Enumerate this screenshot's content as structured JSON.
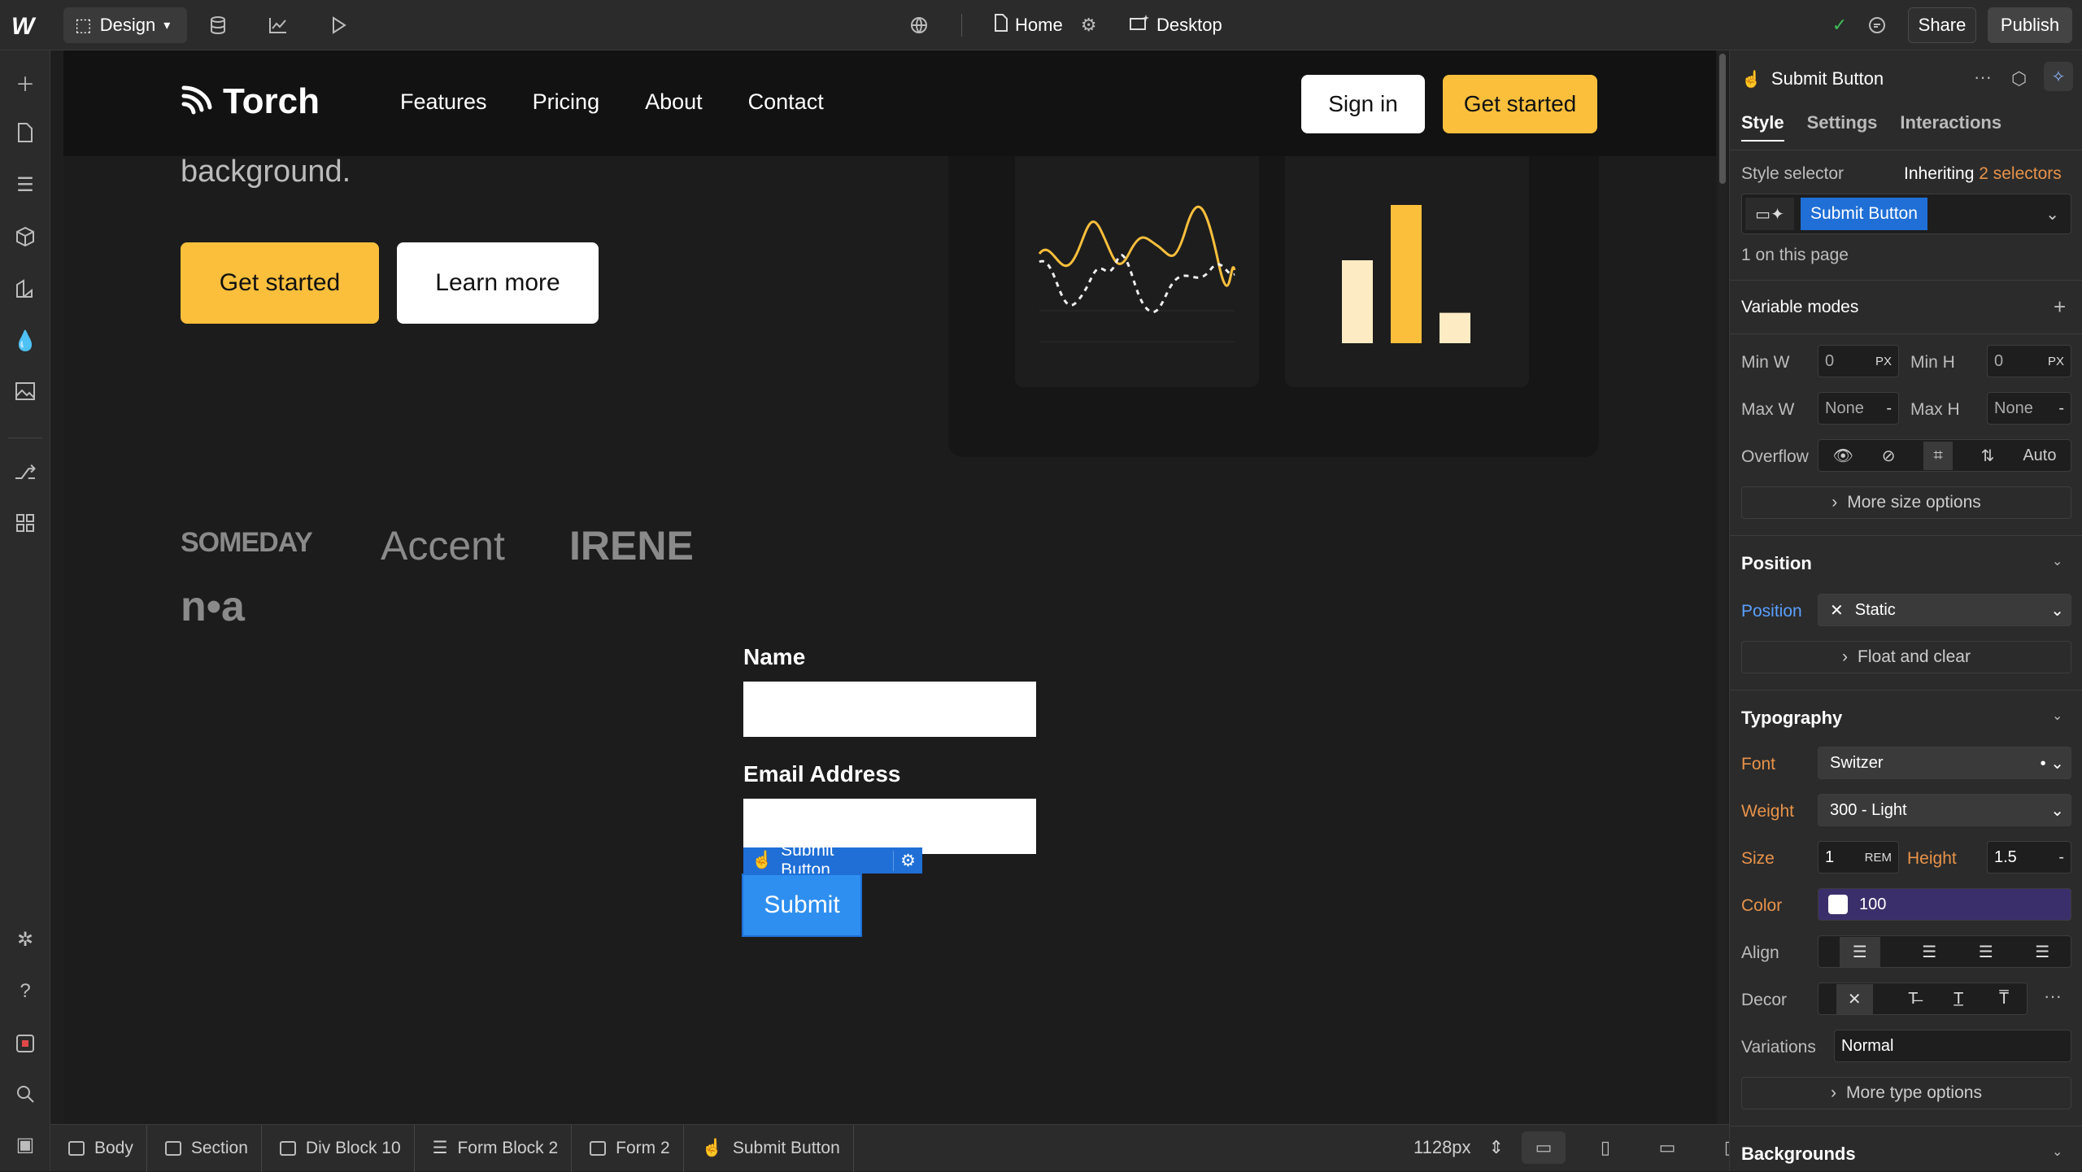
{
  "topbar": {
    "mode_label": "Design",
    "page_name": "Home",
    "device_name": "Desktop",
    "share_label": "Share",
    "publish_label": "Publish"
  },
  "site": {
    "brand": "Torch",
    "nav_links": [
      "Features",
      "Pricing",
      "About",
      "Contact"
    ],
    "signin_label": "Sign in",
    "nav_cta_label": "Get started",
    "hero_text": "background.",
    "hero_cta_primary": "Get started",
    "hero_cta_secondary": "Learn more",
    "logos": [
      "SOMEDAY",
      "Accent",
      "IRENE",
      "n•a"
    ],
    "form": {
      "name_label": "Name",
      "email_label": "Email Address",
      "submit_label": "Submit"
    },
    "bar_heights_fraction": [
      0.6,
      1.0,
      0.22
    ]
  },
  "selection": {
    "tag_label": "Submit Button"
  },
  "breadcrumbs": [
    "Body",
    "Section",
    "Div Block 10",
    "Form Block 2",
    "Form 2",
    "Submit Button"
  ],
  "canvas_width_label": "1128px",
  "panel": {
    "element_name": "Submit Button",
    "tabs": [
      "Style",
      "Settings",
      "Interactions"
    ],
    "style_selector_label": "Style selector",
    "inheriting_prefix": "Inheriting",
    "inheriting_count": "2 selectors",
    "selector_chip": "Submit Button",
    "on_page": "1 on this page",
    "variable_modes": "Variable modes",
    "min_w_label": "Min W",
    "min_w_value": "0",
    "min_h_label": "Min H",
    "min_h_value": "0",
    "max_w_label": "Max W",
    "max_w_value": "None",
    "max_h_label": "Max H",
    "max_h_value": "None",
    "unit_px": "PX",
    "overflow_label": "Overflow",
    "overflow_auto": "Auto",
    "more_size": "More size options",
    "position_section": "Position",
    "position_label": "Position",
    "position_value": "Static",
    "float_clear": "Float and clear",
    "typography_section": "Typography",
    "font_label": "Font",
    "font_value": "Switzer",
    "weight_label": "Weight",
    "weight_value": "300 - Light",
    "size_label": "Size",
    "size_value": "1",
    "size_unit": "REM",
    "height_label": "Height",
    "height_value": "1.5",
    "color_label": "Color",
    "color_value": "100",
    "align_label": "Align",
    "decor_label": "Decor",
    "variations_label": "Variations",
    "variations_value": "Normal",
    "more_type": "More type options",
    "backgrounds_section": "Backgrounds"
  },
  "colors": {
    "accent_yellow": "#fbbf3c",
    "selection_blue": "#1f6fd6",
    "submit_blue": "#2e8ff0",
    "inherited_orange": "#e8934a",
    "color_swatch_bg": "#3b2f6b"
  }
}
